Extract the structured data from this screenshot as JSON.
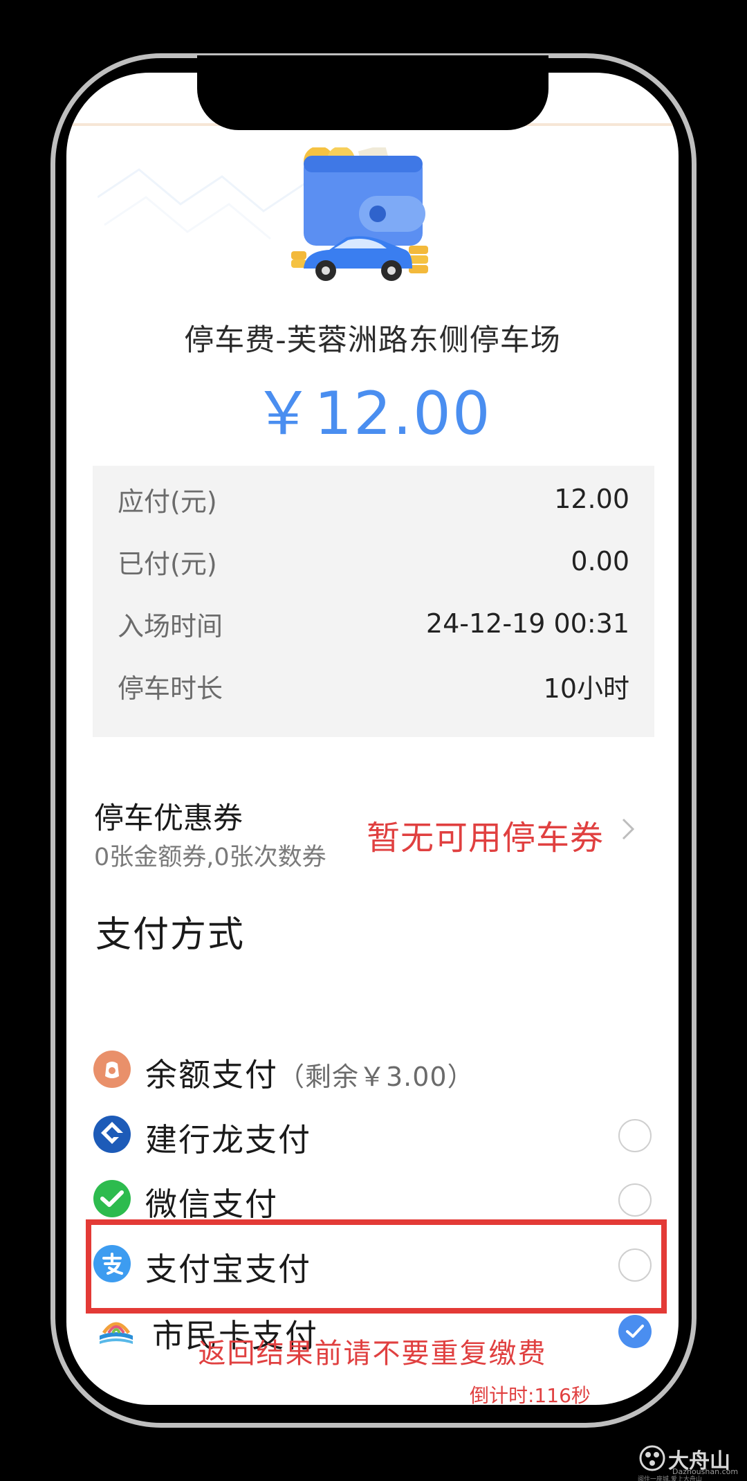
{
  "header": {
    "lot_title": "停车费-芙蓉洲路东侧停车场",
    "amount": "￥12.00"
  },
  "details": [
    {
      "label": "应付(元)",
      "value": "12.00"
    },
    {
      "label": "已付(元)",
      "value": "0.00"
    },
    {
      "label": "入场时间",
      "value": "24-12-19 00:31"
    },
    {
      "label": "停车时长",
      "value": "10小时"
    }
  ],
  "coupon": {
    "title": "停车优惠券",
    "subtitle": "0张金额券,0张次数券",
    "status": "暂无可用停车券"
  },
  "payment": {
    "section_title": "支付方式",
    "methods": [
      {
        "label": "余额支付",
        "extra": "（剩余￥3.00）",
        "icon": "balance-icon",
        "selected": false
      },
      {
        "label": "建行龙支付",
        "icon": "ccb-icon",
        "selected": false
      },
      {
        "label": "微信支付",
        "icon": "wechat-icon",
        "selected": false
      },
      {
        "label": "支付宝支付",
        "icon": "alipay-icon",
        "selected": false
      },
      {
        "label": "市民卡支付",
        "icon": "citizen-card-icon",
        "selected": true
      }
    ]
  },
  "footer": {
    "warning": "返回结果前请不要重复缴费",
    "countdown": "倒计时:116秒"
  },
  "watermark": {
    "brand": "大舟山",
    "domain": "Dazhoushan.com",
    "slogan": "阅住一座城,爱上大舟山"
  },
  "colors": {
    "accent": "#4a8ef0",
    "warning": "#e04040",
    "highlight_border": "#e33a36",
    "detail_bg": "#f3f3f3"
  }
}
